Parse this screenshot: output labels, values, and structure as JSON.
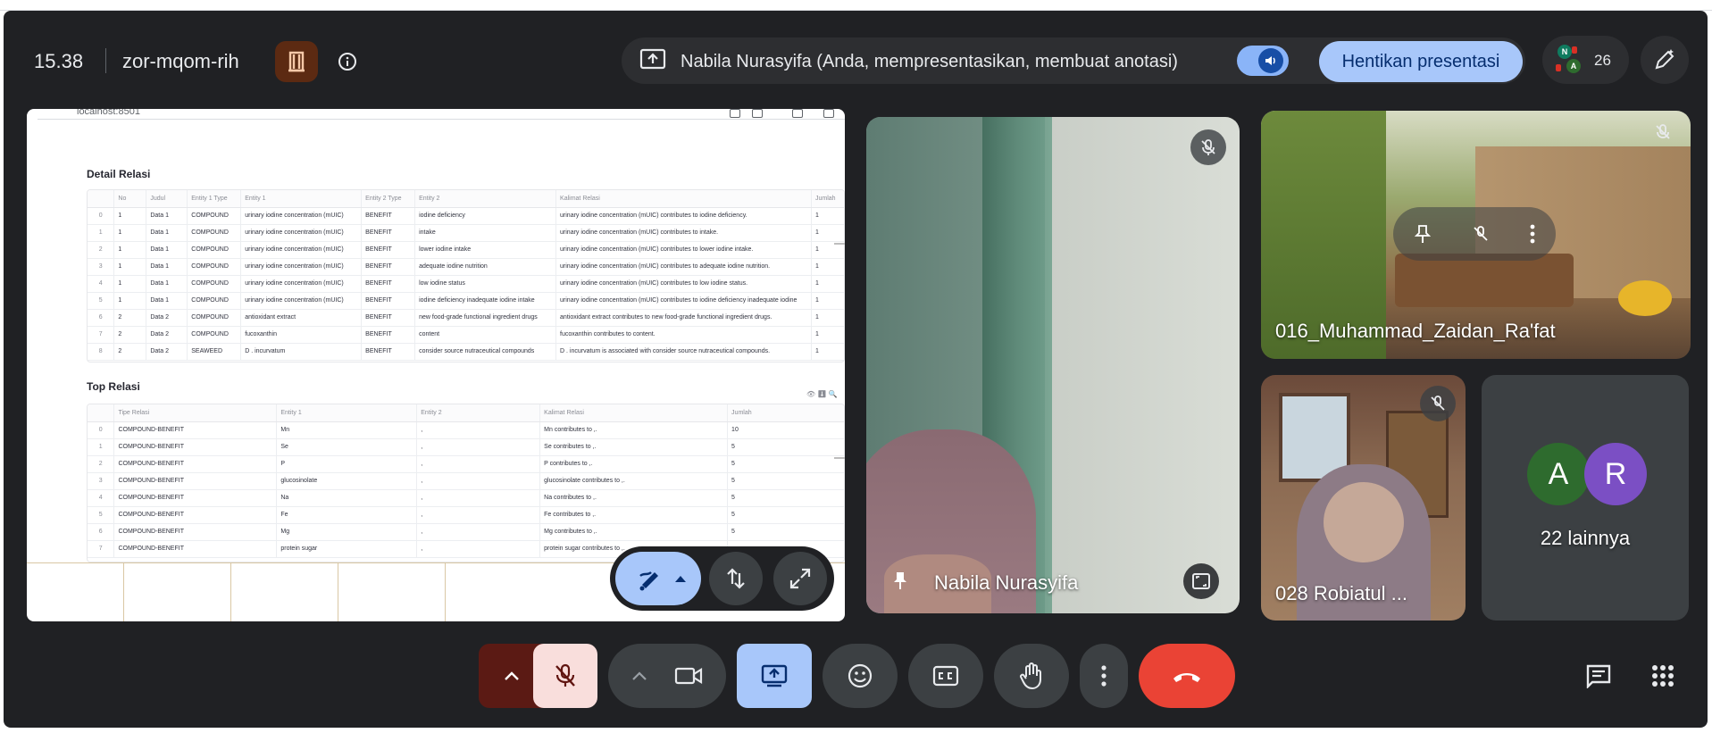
{
  "header": {
    "time": "15.38",
    "meeting_code": "zor-mqom-rih",
    "presenting_status": "Nabila Nurasyifa (Anda, mempresentasikan, membuat anotasi)",
    "stop_presenting_label": "Hentikan presentasi",
    "participant_count": "26",
    "participant_mini_avatars": [
      "N",
      "A"
    ]
  },
  "shared_screen": {
    "url": "localhost:8501",
    "detail": {
      "title": "Detail Relasi",
      "columns": [
        "",
        "No",
        "Judul",
        "Entity 1 Type",
        "Entity 1",
        "Entity 2 Type",
        "Entity 2",
        "Kalimat Relasi",
        "Jumlah"
      ],
      "rows": [
        [
          "0",
          "1",
          "Data 1",
          "COMPOUND",
          "urinary iodine concentration (mUIC)",
          "BENEFIT",
          "iodine deficiency",
          "urinary iodine concentration (mUIC) contributes to iodine deficiency.",
          "1"
        ],
        [
          "1",
          "1",
          "Data 1",
          "COMPOUND",
          "urinary iodine concentration (mUIC)",
          "BENEFIT",
          "intake",
          "urinary iodine concentration (mUIC) contributes to intake.",
          "1"
        ],
        [
          "2",
          "1",
          "Data 1",
          "COMPOUND",
          "urinary iodine concentration (mUIC)",
          "BENEFIT",
          "lower iodine intake",
          "urinary iodine concentration (mUIC) contributes to lower iodine intake.",
          "1"
        ],
        [
          "3",
          "1",
          "Data 1",
          "COMPOUND",
          "urinary iodine concentration (mUIC)",
          "BENEFIT",
          "adequate iodine nutrition",
          "urinary iodine concentration (mUIC) contributes to adequate iodine nutrition.",
          "1"
        ],
        [
          "4",
          "1",
          "Data 1",
          "COMPOUND",
          "urinary iodine concentration (mUIC)",
          "BENEFIT",
          "low iodine status",
          "urinary iodine concentration (mUIC) contributes to low iodine status.",
          "1"
        ],
        [
          "5",
          "1",
          "Data 1",
          "COMPOUND",
          "urinary iodine concentration (mUIC)",
          "BENEFIT",
          "iodine deficiency inadequate iodine intake",
          "urinary iodine concentration (mUIC) contributes to iodine deficiency inadequate iodine",
          "1"
        ],
        [
          "6",
          "2",
          "Data 2",
          "COMPOUND",
          "antioxidant extract",
          "BENEFIT",
          "new food-grade functional ingredient drugs",
          "antioxidant extract contributes to new food-grade functional ingredient drugs.",
          "1"
        ],
        [
          "7",
          "2",
          "Data 2",
          "COMPOUND",
          "fucoxanthin",
          "BENEFIT",
          "content",
          "fucoxanthin contributes to content.",
          "1"
        ],
        [
          "8",
          "2",
          "Data 2",
          "SEAWEED",
          "D . incurvatum",
          "BENEFIT",
          "consider source nutraceutical compounds",
          "D . incurvatum is associated with consider source nutraceutical compounds.",
          "1"
        ]
      ]
    },
    "top": {
      "title": "Top Relasi",
      "columns": [
        "",
        "Tipe Relasi",
        "Entity 1",
        "Entity 2",
        "Kalimat Relasi",
        "Jumlah"
      ],
      "rows": [
        [
          "0",
          "COMPOUND-BENEFIT",
          "Mn",
          ",",
          "Mn contributes to ,.",
          "10"
        ],
        [
          "1",
          "COMPOUND-BENEFIT",
          "Se",
          ",",
          "Se contributes to ,.",
          "5"
        ],
        [
          "2",
          "COMPOUND-BENEFIT",
          "P",
          ",",
          "P contributes to ,.",
          "5"
        ],
        [
          "3",
          "COMPOUND-BENEFIT",
          "glucosinolate",
          ",",
          "glucosinolate contributes to ,.",
          "5"
        ],
        [
          "4",
          "COMPOUND-BENEFIT",
          "Na",
          ",",
          "Na contributes to ,.",
          "5"
        ],
        [
          "5",
          "COMPOUND-BENEFIT",
          "Fe",
          ",",
          "Fe contributes to ,.",
          "5"
        ],
        [
          "6",
          "COMPOUND-BENEFIT",
          "Mg",
          ",",
          "Mg contributes to ,.",
          "5"
        ],
        [
          "7",
          "COMPOUND-BENEFIT",
          "protein sugar",
          ",",
          "protein sugar contributes to ,.",
          ""
        ]
      ]
    }
  },
  "tiles": {
    "main_name": "Nabila Nurasyifa",
    "tile2_name": "016_Muhammad_Zaidan_Ra'fat",
    "tile3_name": "028 Robiatul ...",
    "others_label": "22 lainnya",
    "others_avatars": [
      {
        "letter": "A",
        "color": "#2e6b2e"
      },
      {
        "letter": "R",
        "color": "#7b4fc4"
      }
    ]
  },
  "toolbar": {
    "icons": [
      "chevron-up-icon",
      "mic-off-icon",
      "camera-icon",
      "present-icon",
      "emoji-icon",
      "captions-icon",
      "raise-hand-icon",
      "more-vert-icon",
      "end-call-icon",
      "chat-icon",
      "apps-icon"
    ]
  },
  "colors": {
    "background": "#202124",
    "accent": "#a8c7fa",
    "end_call": "#ea4335",
    "mic_off_bg": "#f9dedc"
  }
}
